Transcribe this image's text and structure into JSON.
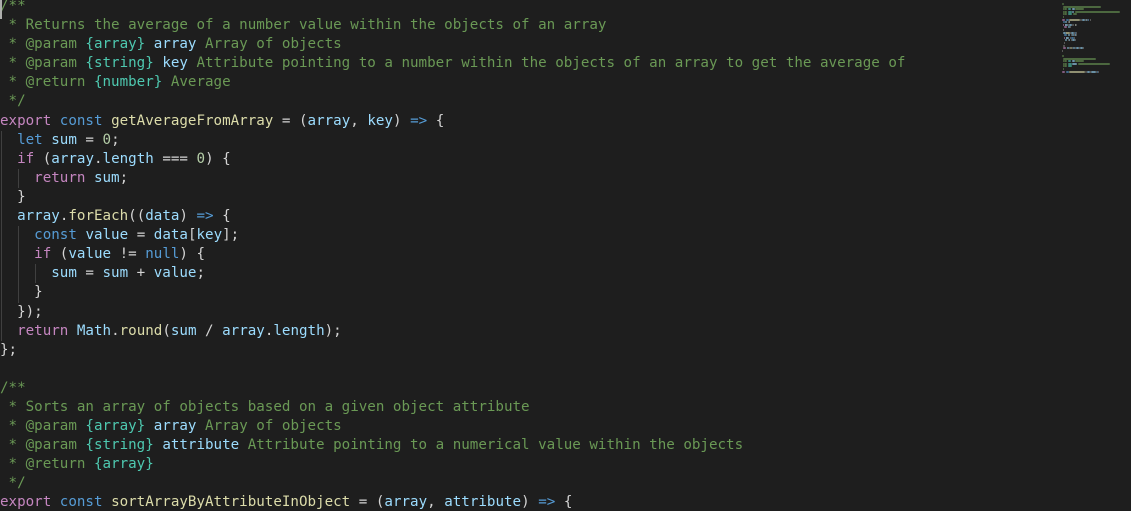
{
  "editor": {
    "lines": [
      [
        {
          "t": "/**",
          "c": "c"
        }
      ],
      [
        {
          "t": " * Returns the average of a number value within the objects of an array",
          "c": "c"
        }
      ],
      [
        {
          "t": " * ",
          "c": "c"
        },
        {
          "t": "@param",
          "c": "c"
        },
        {
          "t": " ",
          "c": "c"
        },
        {
          "t": "{array}",
          "c": "t"
        },
        {
          "t": " ",
          "c": "c"
        },
        {
          "t": "array",
          "c": "v"
        },
        {
          "t": " Array of objects",
          "c": "c"
        }
      ],
      [
        {
          "t": " * ",
          "c": "c"
        },
        {
          "t": "@param",
          "c": "c"
        },
        {
          "t": " ",
          "c": "c"
        },
        {
          "t": "{string}",
          "c": "t"
        },
        {
          "t": " ",
          "c": "c"
        },
        {
          "t": "key",
          "c": "v"
        },
        {
          "t": " Attribute pointing to a number within the objects of an array to get the average of",
          "c": "c"
        }
      ],
      [
        {
          "t": " * ",
          "c": "c"
        },
        {
          "t": "@return",
          "c": "c"
        },
        {
          "t": " ",
          "c": "c"
        },
        {
          "t": "{number}",
          "c": "t"
        },
        {
          "t": " Average",
          "c": "c"
        }
      ],
      [
        {
          "t": " */",
          "c": "c"
        }
      ],
      [
        {
          "t": "export",
          "c": "ctl"
        },
        {
          "t": " ",
          "c": "p"
        },
        {
          "t": "const",
          "c": "k"
        },
        {
          "t": " ",
          "c": "p"
        },
        {
          "t": "getAverageFromArray",
          "c": "f"
        },
        {
          "t": " = (",
          "c": "p"
        },
        {
          "t": "array",
          "c": "v"
        },
        {
          "t": ", ",
          "c": "p"
        },
        {
          "t": "key",
          "c": "v"
        },
        {
          "t": ") ",
          "c": "p"
        },
        {
          "t": "=>",
          "c": "k"
        },
        {
          "t": " {",
          "c": "p"
        }
      ],
      [
        {
          "t": "  ",
          "c": "p"
        },
        {
          "t": "let",
          "c": "k"
        },
        {
          "t": " ",
          "c": "p"
        },
        {
          "t": "sum",
          "c": "v"
        },
        {
          "t": " = ",
          "c": "p"
        },
        {
          "t": "0",
          "c": "n"
        },
        {
          "t": ";",
          "c": "p"
        }
      ],
      [
        {
          "t": "  ",
          "c": "p"
        },
        {
          "t": "if",
          "c": "ctl"
        },
        {
          "t": " (",
          "c": "p"
        },
        {
          "t": "array",
          "c": "v"
        },
        {
          "t": ".",
          "c": "p"
        },
        {
          "t": "length",
          "c": "v"
        },
        {
          "t": " === ",
          "c": "p"
        },
        {
          "t": "0",
          "c": "n"
        },
        {
          "t": ") {",
          "c": "p"
        }
      ],
      [
        {
          "t": "    ",
          "c": "p"
        },
        {
          "t": "return",
          "c": "ctl"
        },
        {
          "t": " ",
          "c": "p"
        },
        {
          "t": "sum",
          "c": "v"
        },
        {
          "t": ";",
          "c": "p"
        }
      ],
      [
        {
          "t": "  }",
          "c": "p"
        }
      ],
      [
        {
          "t": "  ",
          "c": "p"
        },
        {
          "t": "array",
          "c": "v"
        },
        {
          "t": ".",
          "c": "p"
        },
        {
          "t": "forEach",
          "c": "f"
        },
        {
          "t": "((",
          "c": "p"
        },
        {
          "t": "data",
          "c": "v"
        },
        {
          "t": ") ",
          "c": "p"
        },
        {
          "t": "=>",
          "c": "k"
        },
        {
          "t": " {",
          "c": "p"
        }
      ],
      [
        {
          "t": "    ",
          "c": "p"
        },
        {
          "t": "const",
          "c": "k"
        },
        {
          "t": " ",
          "c": "p"
        },
        {
          "t": "value",
          "c": "v"
        },
        {
          "t": " = ",
          "c": "p"
        },
        {
          "t": "data",
          "c": "v"
        },
        {
          "t": "[",
          "c": "p"
        },
        {
          "t": "key",
          "c": "v"
        },
        {
          "t": "];",
          "c": "p"
        }
      ],
      [
        {
          "t": "    ",
          "c": "p"
        },
        {
          "t": "if",
          "c": "ctl"
        },
        {
          "t": " (",
          "c": "p"
        },
        {
          "t": "value",
          "c": "v"
        },
        {
          "t": " != ",
          "c": "p"
        },
        {
          "t": "null",
          "c": "k"
        },
        {
          "t": ") {",
          "c": "p"
        }
      ],
      [
        {
          "t": "      ",
          "c": "p"
        },
        {
          "t": "sum",
          "c": "v"
        },
        {
          "t": " = ",
          "c": "p"
        },
        {
          "t": "sum",
          "c": "v"
        },
        {
          "t": " + ",
          "c": "p"
        },
        {
          "t": "value",
          "c": "v"
        },
        {
          "t": ";",
          "c": "p"
        }
      ],
      [
        {
          "t": "    }",
          "c": "p"
        }
      ],
      [
        {
          "t": "  });",
          "c": "p"
        }
      ],
      [
        {
          "t": "  ",
          "c": "p"
        },
        {
          "t": "return",
          "c": "ctl"
        },
        {
          "t": " ",
          "c": "p"
        },
        {
          "t": "Math",
          "c": "v"
        },
        {
          "t": ".",
          "c": "p"
        },
        {
          "t": "round",
          "c": "f"
        },
        {
          "t": "(",
          "c": "p"
        },
        {
          "t": "sum",
          "c": "v"
        },
        {
          "t": " / ",
          "c": "p"
        },
        {
          "t": "array",
          "c": "v"
        },
        {
          "t": ".",
          "c": "p"
        },
        {
          "t": "length",
          "c": "v"
        },
        {
          "t": ");",
          "c": "p"
        }
      ],
      [
        {
          "t": "};",
          "c": "p"
        }
      ],
      [],
      [
        {
          "t": "/**",
          "c": "c"
        }
      ],
      [
        {
          "t": " * Sorts an array of objects based on a given object attribute",
          "c": "c"
        }
      ],
      [
        {
          "t": " * ",
          "c": "c"
        },
        {
          "t": "@param",
          "c": "c"
        },
        {
          "t": " ",
          "c": "c"
        },
        {
          "t": "{array}",
          "c": "t"
        },
        {
          "t": " ",
          "c": "c"
        },
        {
          "t": "array",
          "c": "v"
        },
        {
          "t": " Array of objects",
          "c": "c"
        }
      ],
      [
        {
          "t": " * ",
          "c": "c"
        },
        {
          "t": "@param",
          "c": "c"
        },
        {
          "t": " ",
          "c": "c"
        },
        {
          "t": "{string}",
          "c": "t"
        },
        {
          "t": " ",
          "c": "c"
        },
        {
          "t": "attribute",
          "c": "v"
        },
        {
          "t": " Attribute pointing to a numerical value within the objects",
          "c": "c"
        }
      ],
      [
        {
          "t": " * ",
          "c": "c"
        },
        {
          "t": "@return",
          "c": "c"
        },
        {
          "t": " ",
          "c": "c"
        },
        {
          "t": "{array}",
          "c": "t"
        }
      ],
      [
        {
          "t": " */",
          "c": "c"
        }
      ],
      [
        {
          "t": "export",
          "c": "ctl"
        },
        {
          "t": " ",
          "c": "p"
        },
        {
          "t": "const",
          "c": "k"
        },
        {
          "t": " ",
          "c": "p"
        },
        {
          "t": "sortArrayByAttributeInObject",
          "c": "f"
        },
        {
          "t": " = (",
          "c": "p"
        },
        {
          "t": "array",
          "c": "v"
        },
        {
          "t": ", ",
          "c": "p"
        },
        {
          "t": "attribute",
          "c": "v"
        },
        {
          "t": ") ",
          "c": "p"
        },
        {
          "t": "=>",
          "c": "k"
        },
        {
          "t": " {",
          "c": "p"
        }
      ]
    ],
    "colors": {
      "background": "#1e1e1e",
      "comment": "#6a9955",
      "keyword": "#569cd6",
      "function": "#dcdcaa",
      "variable": "#9cdcfe",
      "number": "#b5cea8",
      "type": "#4ec9b0",
      "control": "#c586c0"
    }
  }
}
